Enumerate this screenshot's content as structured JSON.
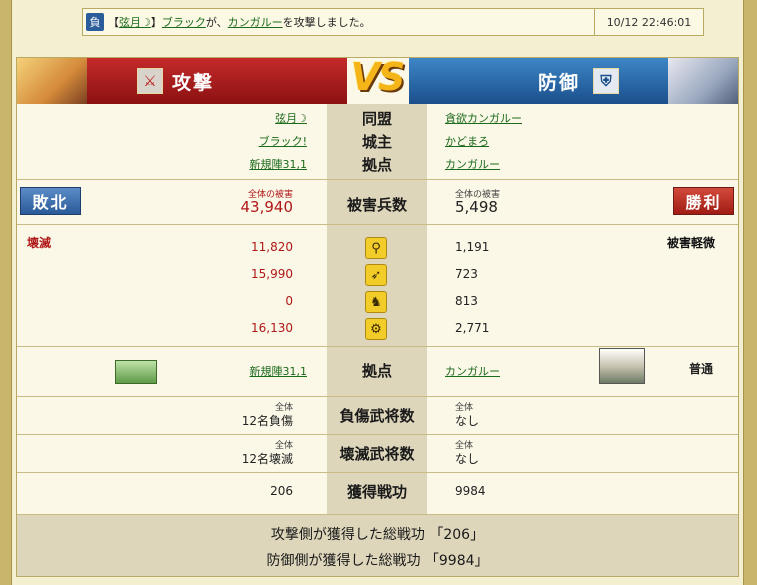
{
  "log": {
    "badge": "負",
    "msg_pre": "【",
    "alliance": "弦月☽",
    "msg_mid": "】",
    "attacker": "ブラック",
    "msg_ga": "が、",
    "target": "カンガルー",
    "msg_post": "を攻撃しました。",
    "time": "10/12 22:46:01"
  },
  "header": {
    "attack_label": "攻撃",
    "defense_label": "防御",
    "vs": "VS",
    "attack_icon": "crossed-swords-icon",
    "defense_icon": "helmet-icon"
  },
  "info": {
    "alliance_label": "同盟",
    "lord_label": "城主",
    "base_label": "拠点",
    "atk_alliance": "弦月☽",
    "atk_lord": "ブラック!",
    "atk_base": "新規陣31,1",
    "def_alliance": "貪欲カンガルー",
    "def_lord": "かどまろ",
    "def_base": "カンガルー"
  },
  "damage": {
    "label": "被害兵数",
    "total_label": "全体の被害",
    "atk_total": "43,940",
    "def_total": "5,498",
    "atk_result": "敗北",
    "def_result": "勝利"
  },
  "units": {
    "atk_status": "壊滅",
    "def_status": "被害軽微",
    "rows": [
      {
        "icon": "spearman-icon",
        "atk": "11,820",
        "def": "1,191"
      },
      {
        "icon": "archer-icon",
        "atk": "15,990",
        "def": "723"
      },
      {
        "icon": "cavalry-icon",
        "atk": "0",
        "def": "813"
      },
      {
        "icon": "siege-icon",
        "atk": "16,130",
        "def": "2,771"
      }
    ]
  },
  "base": {
    "label": "拠点",
    "atk": "新規陣31,1",
    "def": "カンガルー",
    "def_status": "普通"
  },
  "injured": {
    "label": "負傷武将数",
    "sub": "全体",
    "atk": "12名負傷",
    "def": "なし"
  },
  "destroyed": {
    "label": "壊滅武将数",
    "sub": "全体",
    "atk": "12名壊滅",
    "def": "なし"
  },
  "merit": {
    "label": "獲得戦功",
    "atk": "206",
    "def": "9984"
  },
  "summary": {
    "line1": "攻撃側が獲得した総戦功 「206」",
    "line2": "防御側が獲得した総戦功 「9984」"
  }
}
